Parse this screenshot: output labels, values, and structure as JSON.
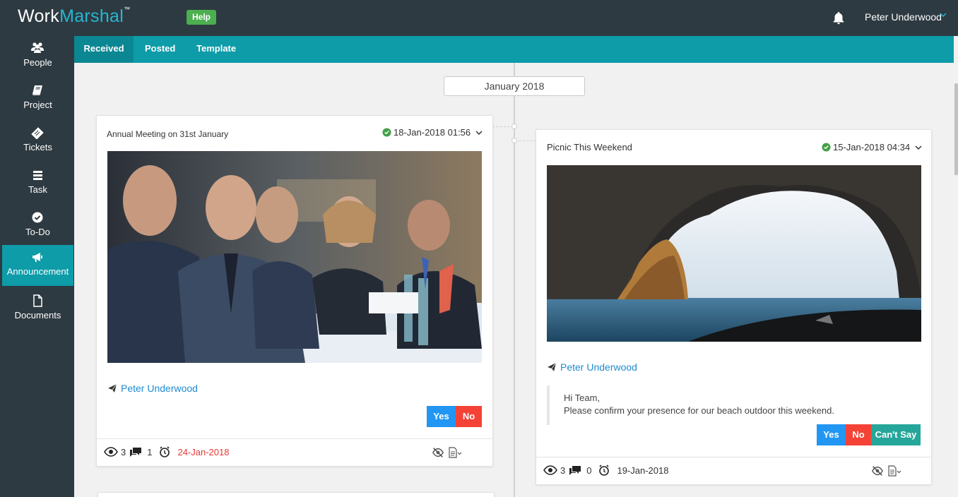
{
  "app": {
    "logo_main": "Work",
    "logo_accent": "Marshal",
    "logo_tm": "™",
    "help_label": "Help",
    "user_name": "Peter Underwood"
  },
  "sidebar": {
    "items": [
      {
        "label": "People",
        "icon": "people-icon"
      },
      {
        "label": "Project",
        "icon": "book-icon"
      },
      {
        "label": "Tickets",
        "icon": "ticket-icon"
      },
      {
        "label": "Task",
        "icon": "list-icon"
      },
      {
        "label": "To-Do",
        "icon": "check-circle-icon"
      },
      {
        "label": "Announcement",
        "icon": "megaphone-icon",
        "active": true
      },
      {
        "label": "Documents",
        "icon": "document-icon"
      }
    ]
  },
  "tabs": [
    {
      "label": "Received",
      "active": true
    },
    {
      "label": "Posted"
    },
    {
      "label": "Template"
    }
  ],
  "timeline": {
    "month": "January 2018"
  },
  "cards": [
    {
      "title": "Annual Meeting on 31st January",
      "datetime": "18-Jan-2018 01:56",
      "image_desc": "business-meeting-photo",
      "author": "Peter Underwood",
      "buttons": {
        "yes": "Yes",
        "no": "No"
      },
      "views": "3",
      "comments": "1",
      "due": "24-Jan-2018",
      "due_overdue": true
    },
    {
      "title": "Picnic This Weekend",
      "datetime": "15-Jan-2018 04:34",
      "image_desc": "sea-cave-photo",
      "author": "Peter Underwood",
      "message_line1": "Hi Team,",
      "message_line2": "Please confirm your presence for our beach outdoor this weekend.",
      "buttons": {
        "yes": "Yes",
        "no": "No",
        "cant": "Can't Say"
      },
      "views": "3",
      "comments": "0",
      "due": "19-Jan-2018",
      "due_overdue": false
    }
  ],
  "colors": {
    "topbar": "#2e3a41",
    "accent_teal": "#0d9ca8",
    "link_blue": "#1f8bd0",
    "yes_blue": "#2196f3",
    "no_red": "#f44336",
    "cant_green": "#26a69a",
    "help_green": "#4caf50"
  }
}
